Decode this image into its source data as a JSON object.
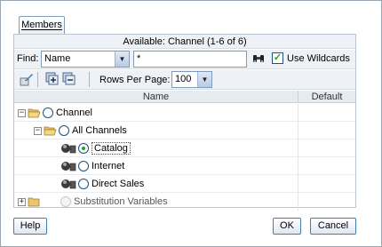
{
  "tab": {
    "label": "Members"
  },
  "available": {
    "text": "Available:  Channel (1-6 of 6)"
  },
  "find": {
    "label": "Find:",
    "field_select": "Name",
    "query": "*",
    "wildcards_label": "Use Wildcards",
    "wildcards_checked": true
  },
  "toolbar": {
    "icons": [
      "edit-member-icon",
      "expand-all-icon",
      "collapse-all-icon"
    ],
    "rows_per_page_label": "Rows Per Page:",
    "rows_per_page_value": "100"
  },
  "columns": {
    "name": "Name",
    "default": "Default"
  },
  "tree": [
    {
      "label": "Channel",
      "expanded": true,
      "selected": false,
      "kind": "folder"
    },
    {
      "label": "All Channels",
      "expanded": true,
      "selected": false,
      "kind": "folder"
    },
    {
      "label": "Catalog",
      "selected": true,
      "kind": "leaf"
    },
    {
      "label": "Internet",
      "selected": false,
      "kind": "leaf"
    },
    {
      "label": "Direct Sales",
      "selected": false,
      "kind": "leaf"
    },
    {
      "label": "Substitution Variables",
      "expanded": false,
      "selected": false,
      "kind": "folder",
      "disabled": true
    }
  ],
  "buttons": {
    "help": "Help",
    "ok": "OK",
    "cancel": "Cancel"
  },
  "colors": {
    "accent_green": "#21a121",
    "border_blue": "#7f9db9"
  }
}
